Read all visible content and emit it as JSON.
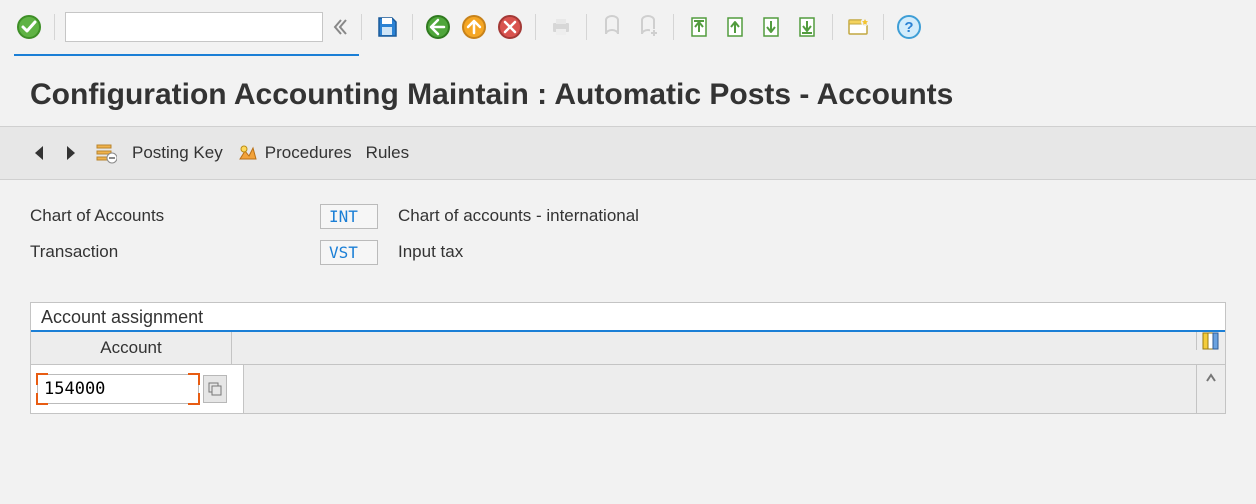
{
  "toolbar": {
    "command_value": ""
  },
  "page": {
    "title": "Configuration Accounting Maintain : Automatic Posts - Accounts"
  },
  "appbar": {
    "posting_key": "Posting Key",
    "procedures": "Procedures",
    "rules": "Rules"
  },
  "fields": {
    "chart_label": "Chart of Accounts",
    "chart_code": "INT",
    "chart_desc": "Chart of accounts - international",
    "txn_label": "Transaction",
    "txn_code": "VST",
    "txn_desc": "Input tax"
  },
  "assignment": {
    "panel_title": "Account assignment",
    "col_account": "Account",
    "account_value": "154000"
  }
}
